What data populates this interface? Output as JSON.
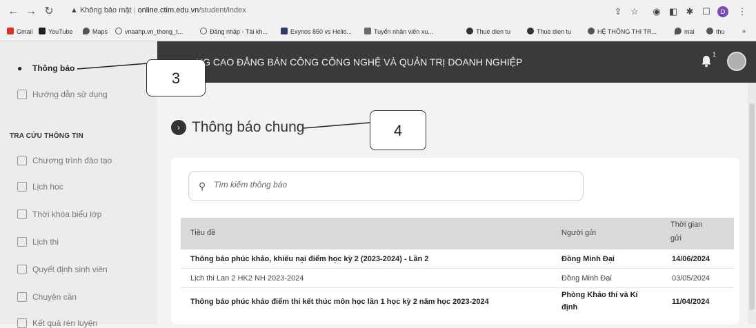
{
  "browser": {
    "back_icon": "arrow-left-icon",
    "forward_icon": "arrow-right-icon",
    "reload_icon": "reload-icon",
    "security_label": "Không bảo mật",
    "url_host": "online.ctim.edu.vn",
    "url_path": "/student/index",
    "bookmarks": [
      {
        "label": "Gmail",
        "color": "#d93025"
      },
      {
        "label": "YouTube",
        "color": "#222222"
      },
      {
        "label": "Maps",
        "color": "#555555"
      },
      {
        "label": "vnaahp.vn_thong_t...",
        "color": "#555555"
      },
      {
        "label": "Đăng nhập - Tài kh...",
        "color": "#555555"
      },
      {
        "label": "Exynos 850 vs Helio...",
        "color": "#2d3a6b"
      },
      {
        "label": "Tuyển nhân viên xu...",
        "color": "#6b6b6b"
      },
      {
        "label": "Thue dien tu",
        "color": "#333333"
      },
      {
        "label": "Thue dien tu",
        "color": "#333333"
      },
      {
        "label": "HỆ THỐNG THI TR...",
        "color": "#555555"
      },
      {
        "label": "mai",
        "color": "#555555"
      },
      {
        "label": "thu",
        "color": "#555555"
      }
    ],
    "more_bookmarks": "»"
  },
  "sidebar": {
    "top_items": [
      {
        "label": "Thông báo",
        "icon": "bell-icon"
      },
      {
        "label": "Hướng dẫn sử dụng",
        "icon": "document-icon"
      }
    ],
    "section_title": "TRA CỨU THÔNG TIN",
    "items": [
      {
        "label": "Chương trình đào tạo",
        "icon": "curriculum-icon"
      },
      {
        "label": "Lịch học",
        "icon": "calendar-icon"
      },
      {
        "label": "Thời khóa biểu lớp",
        "icon": "timetable-icon"
      },
      {
        "label": "Lịch thi",
        "icon": "exam-calendar-icon"
      },
      {
        "label": "Quyết định sinh viên",
        "icon": "decision-icon"
      },
      {
        "label": "Chuyên cần",
        "icon": "attendance-icon"
      },
      {
        "label": "Kết quả rèn luyện",
        "icon": "training-result-icon"
      }
    ]
  },
  "header": {
    "title": "NG CAO ĐẲNG BÁN CÔNG CÔNG NGHỆ VÀ QUẢN TRỊ DOANH NGHIỆP",
    "notification_count": "1"
  },
  "main": {
    "heading": "Thông báo chung",
    "search_placeholder": "Tìm kiếm thông báo",
    "columns": {
      "title": "Tiêu đề",
      "sender": "Người gửi",
      "time_line1": "Thời gian",
      "time_line2": "gửi"
    },
    "rows": [
      {
        "title": "Thông báo phúc khảo, khiếu nại điểm học kỳ 2 (2023-2024) - Lần 2",
        "sender": "Đồng Minh Đại",
        "time": "14/06/2024",
        "bold": true
      },
      {
        "title": "Lịch thi Lan 2 HK2 NH 2023-2024",
        "sender": "Đồng Minh Đại",
        "time": "03/05/2024",
        "bold": false
      },
      {
        "title": "Thông báo phúc khảo điểm thi kết thúc môn học lần 1 học kỳ 2 năm học 2023-2024",
        "sender_line1": "Phòng Khảo thí và Kí",
        "sender_line2": "định",
        "time": "11/04/2024",
        "bold": true
      }
    ]
  },
  "annotations": {
    "box_3": "3",
    "box_4": "4"
  }
}
